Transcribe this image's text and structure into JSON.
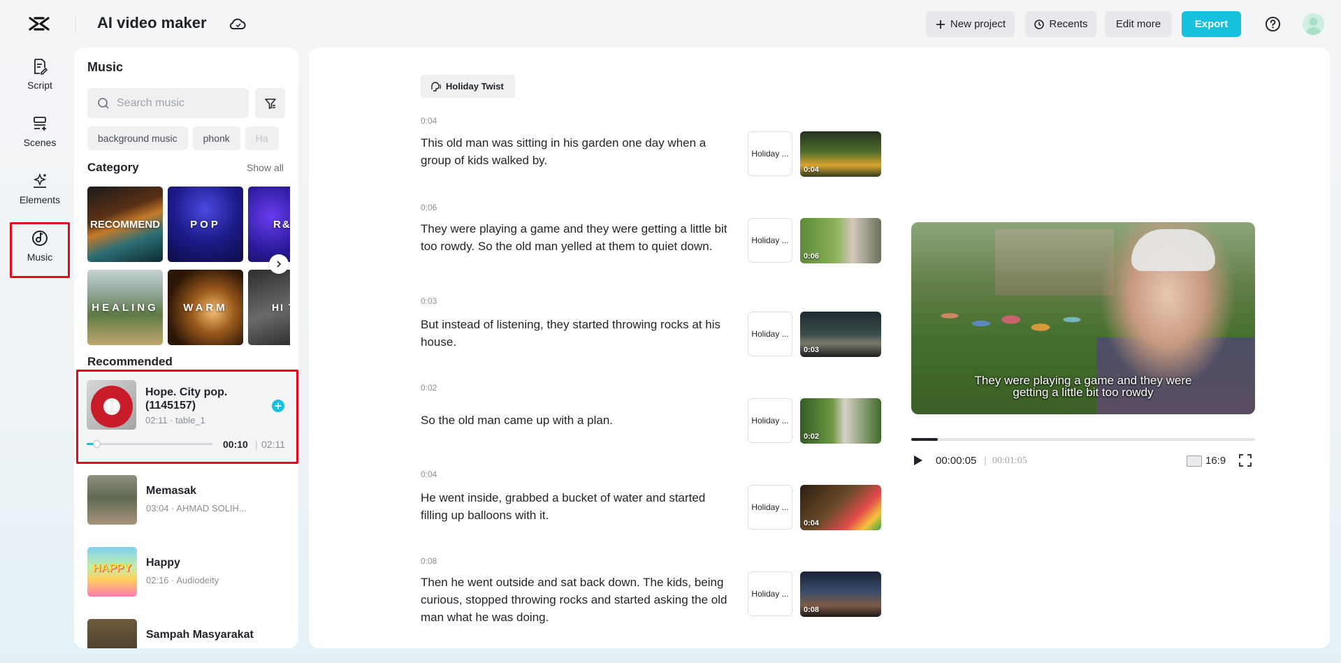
{
  "app": {
    "title": "AI video maker"
  },
  "toolbar": {
    "new_project": "New project",
    "recents": "Recents",
    "edit_more": "Edit more",
    "export": "Export",
    "accent_color": "#15c1dc"
  },
  "rail": {
    "items": [
      {
        "label": "Script",
        "icon": "script-icon"
      },
      {
        "label": "Scenes",
        "icon": "scenes-icon"
      },
      {
        "label": "Elements",
        "icon": "elements-icon"
      },
      {
        "label": "Music",
        "icon": "music-icon",
        "selected": true
      }
    ]
  },
  "music": {
    "title": "Music",
    "search_placeholder": "Search music",
    "chips": [
      "background music",
      "phonk",
      "Ha"
    ],
    "category_title": "Category",
    "show_all": "Show all",
    "categories": [
      "RECOMMEND",
      "POP",
      "R&",
      "HEALING",
      "WARM",
      "HI TEM"
    ],
    "recommended_title": "Recommended",
    "active_track": {
      "name": "Hope. City pop. (1145157)",
      "meta": "02:11 · table_1",
      "current_time": "00:10",
      "separator": "|",
      "total_time": "02:11",
      "progress_fraction": 0.076
    },
    "tracks": [
      {
        "name": "Memasak",
        "meta": "03:04 · AHMAD SOLIH..."
      },
      {
        "name": "Happy",
        "meta": "02:16 · Audiodeity",
        "thumb_text": "HAPPY"
      },
      {
        "name": "Sampah Masyarakat",
        "meta": ""
      }
    ]
  },
  "script": {
    "voice": "Holiday Twist",
    "scenes": [
      {
        "duration": "0:04",
        "text": "This old man was sitting in his garden one day when a group of kids walked by.",
        "voice_short": "Holiday ...",
        "clip_duration": "0:04"
      },
      {
        "duration": "0:06",
        "text": "They were playing a game and they were getting a little bit too rowdy. So the old man yelled at them to quiet down.",
        "voice_short": "Holiday ...",
        "clip_duration": "0:06"
      },
      {
        "duration": "0:03",
        "text": "But instead of listening, they started throwing rocks at his house.",
        "voice_short": "Holiday ...",
        "clip_duration": "0:03"
      },
      {
        "duration": "0:02",
        "text": "So the old man came up with a plan.",
        "voice_short": "Holiday ...",
        "clip_duration": "0:02"
      },
      {
        "duration": "0:04",
        "text": "He went inside, grabbed a bucket of water and started filling up balloons with it.",
        "voice_short": "Holiday ...",
        "clip_duration": "0:04"
      },
      {
        "duration": "0:08",
        "text": "Then he went outside and sat back down. The kids, being curious, stopped throwing rocks and started asking the old man what he was doing.",
        "voice_short": "Holiday ...",
        "clip_duration": "0:08"
      }
    ]
  },
  "preview": {
    "caption_line1": "They were playing a game and they were",
    "caption_line2": "getting a little bit too rowdy",
    "current_time": "00:00:05",
    "separator": "|",
    "total_time": "00:01:05",
    "progress_fraction": 0.077,
    "aspect_ratio": "16:9"
  }
}
